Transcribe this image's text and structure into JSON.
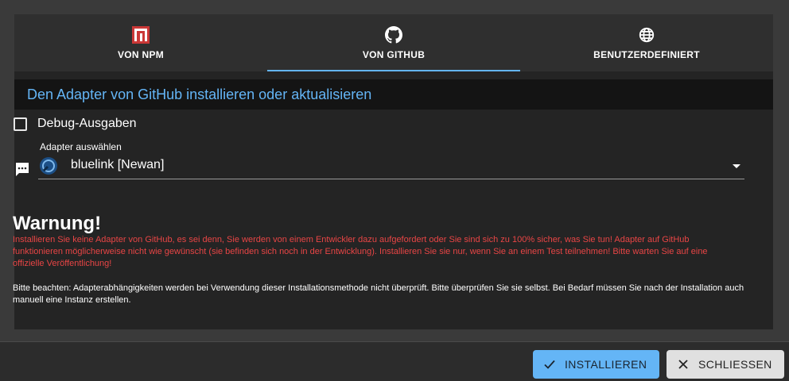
{
  "tabs": [
    {
      "label": "VON NPM",
      "icon": "npm-icon"
    },
    {
      "label": "VON GITHUB",
      "icon": "github-icon",
      "active": true
    },
    {
      "label": "BENUTZERDEFINIERT",
      "icon": "globe-icon"
    }
  ],
  "header": {
    "title": "Den Adapter von GitHub installieren oder aktualisieren"
  },
  "debug": {
    "label": "Debug-Ausgaben",
    "checked": false
  },
  "adapter_select": {
    "caption": "Adapter auswählen",
    "value": "bluelink [Newan]",
    "side_icon": "message-icon",
    "arrow_icon": "dropdown-arrow-icon"
  },
  "warning": {
    "title": "Warnung!",
    "text": "Installieren Sie keine Adapter von GitHub, es sei denn, Sie werden von einem Entwickler dazu aufgefordert oder Sie sind sich zu 100% sicher, was Sie tun! Adapter auf GitHub funktionieren möglicherweise nicht wie gewünscht (sie befinden sich noch in der Entwicklung). Installieren Sie sie nur, wenn Sie an einem Test teilnehmen! Bitte warten Sie auf eine offizielle Veröffentlichung!"
  },
  "note": {
    "text": "Bitte beachten: Adapterabhängigkeiten werden bei Verwendung dieser Installationsmethode nicht überprüft. Bitte überprüfen Sie sie selbst. Bei Bedarf müssen Sie nach der Installation auch manuell eine Instanz erstellen."
  },
  "buttons": {
    "install": {
      "label": "INSTALLIEREN",
      "icon": "check-icon"
    },
    "close": {
      "label": "SCHLIESSEN",
      "icon": "close-icon"
    }
  },
  "colors": {
    "accent": "#64b5f6",
    "warning": "#e84545",
    "background": "#242424",
    "npm_red": "#cb3837"
  }
}
